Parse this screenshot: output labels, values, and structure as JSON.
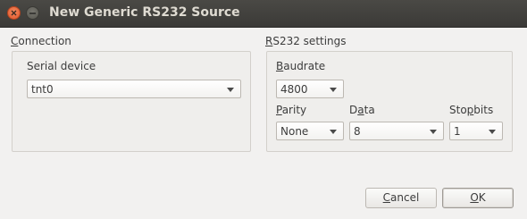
{
  "window": {
    "title": "New Generic RS232 Source"
  },
  "connection": {
    "label_mnemonic": "C",
    "label_rest": "onnection",
    "serial_device_label": "Serial device",
    "serial_device_value": "tnt0"
  },
  "rs232": {
    "label_mnemonic": "R",
    "label_rest": "S232 settings",
    "baudrate_label_mnemonic": "B",
    "baudrate_label_rest": "audrate",
    "baudrate_value": "4800",
    "parity_label_mnemonic": "P",
    "parity_label_rest": "arity",
    "parity_value": "None",
    "data_label_pre": "D",
    "data_label_mnemonic": "a",
    "data_label_rest": "ta",
    "data_value": "8",
    "stopbits_label_pre": "Sto",
    "stopbits_label_mnemonic": "p",
    "stopbits_label_rest": "bits",
    "stopbits_value": "1"
  },
  "buttons": {
    "cancel_mnemonic": "C",
    "cancel_rest": "ancel",
    "ok_mnemonic": "O",
    "ok_rest": "K"
  },
  "icons": {
    "close": "close-icon",
    "minimize": "minimize-icon",
    "dropdown": "chevron-down-icon"
  }
}
